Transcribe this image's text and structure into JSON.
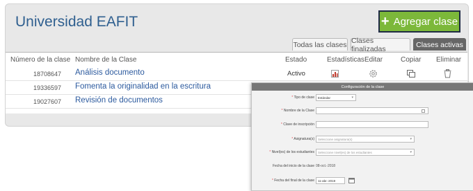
{
  "header": {
    "title": "Universidad EAFIT",
    "add_button_label": "Agregar clase"
  },
  "tabs": [
    {
      "label": "Todas las clases"
    },
    {
      "label": "Clases finalizadas"
    },
    {
      "label": "Clases activas",
      "active": true
    }
  ],
  "table": {
    "headers": [
      "Número de la clase",
      "Nombre de la Clase",
      "Estado",
      "Estadísticas",
      "Editar",
      "Copiar",
      "Eliminar"
    ],
    "rows": [
      {
        "number": "18708647",
        "name": "Análisis documento",
        "status": "Activo"
      },
      {
        "number": "19336597",
        "name": "Fomenta la originalidad en la escritura",
        "status": ""
      },
      {
        "number": "19027607",
        "name": "Revisión de documentos",
        "status": ""
      }
    ]
  },
  "dialog": {
    "title": "Configuración de la clase",
    "fields": [
      {
        "label": "Tipo de clase",
        "value": "Estándar",
        "kind": "select"
      },
      {
        "label": "Nombre de la Clase",
        "value": "",
        "kind": "text"
      },
      {
        "label": "Clave de inscripción",
        "value": "",
        "kind": "text"
      },
      {
        "label": "Asignatura(s)",
        "value": "Seleccione asignatura(s)",
        "kind": "select"
      },
      {
        "label": "Nivel(es) de los estudiantes",
        "value": "Seleccione nivel(es) de los estudiantes",
        "kind": "select"
      },
      {
        "label": "Fecha del inicio de la clase",
        "value": "08-oct.-2018",
        "kind": "static"
      },
      {
        "label": "Fecha del final de la clase",
        "value": "11-abr.-2019",
        "kind": "date"
      }
    ]
  },
  "colors": {
    "accent_green": "#7cb83a",
    "title_blue": "#2f5f8f",
    "link_blue": "#2c5a9e",
    "required_red": "#e5484d"
  }
}
